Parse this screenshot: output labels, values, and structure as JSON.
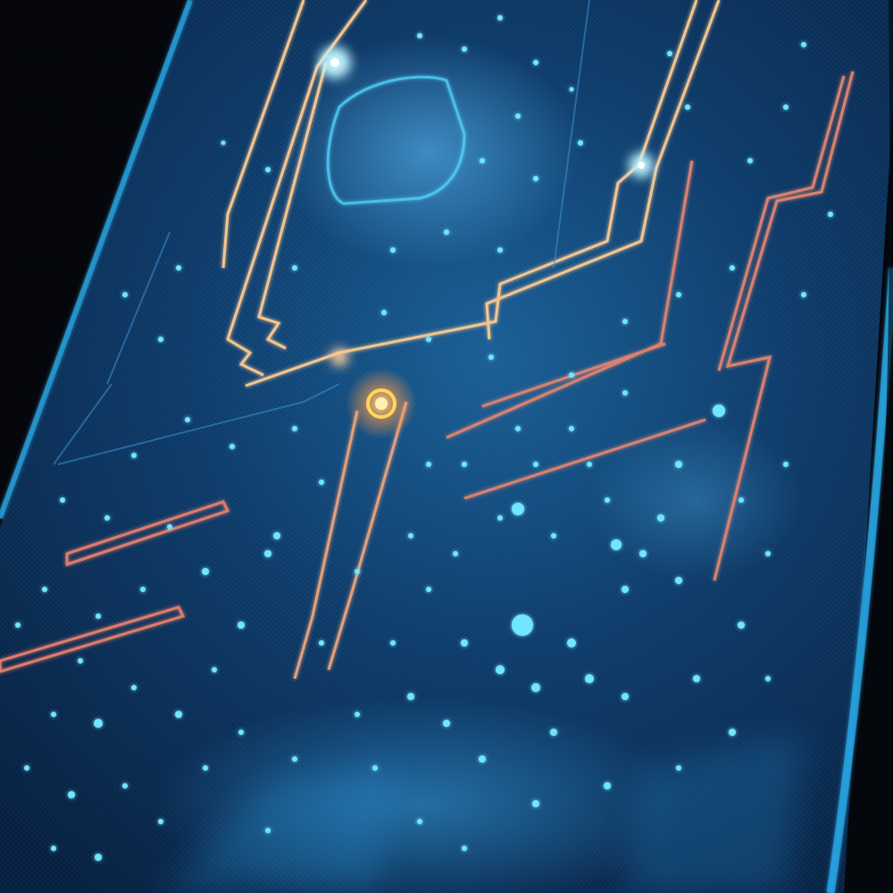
{
  "scene": {
    "subject": "glowing-circuit-panel",
    "icons": [
      "circuit-trace-icon",
      "glowing-node-icon",
      "light-dot-icon"
    ],
    "colors": {
      "background": "#05070c",
      "panel_base": "#0b2f55",
      "panel_glow": "#1f6fb0",
      "edge_glow": "#2aa7e6",
      "trace_gold": "#f4c58f",
      "trace_copper": "#d9826f",
      "dot_cyan": "#6fe6ff",
      "node_core": "#ffd65a"
    }
  }
}
